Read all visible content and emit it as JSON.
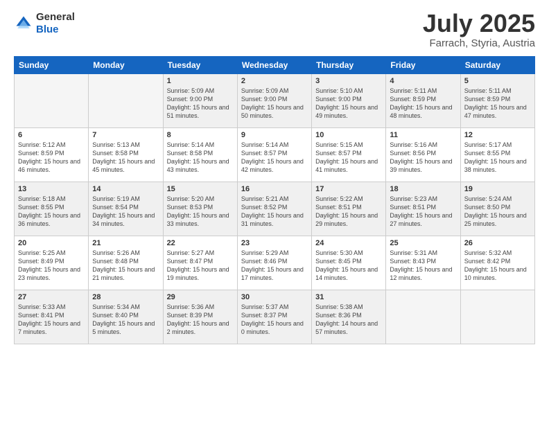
{
  "header": {
    "logo_general": "General",
    "logo_blue": "Blue",
    "month": "July 2025",
    "location": "Farrach, Styria, Austria"
  },
  "weekdays": [
    "Sunday",
    "Monday",
    "Tuesday",
    "Wednesday",
    "Thursday",
    "Friday",
    "Saturday"
  ],
  "rows": [
    [
      {
        "day": "",
        "sunrise": "",
        "sunset": "",
        "daylight": ""
      },
      {
        "day": "",
        "sunrise": "",
        "sunset": "",
        "daylight": ""
      },
      {
        "day": "1",
        "sunrise": "Sunrise: 5:09 AM",
        "sunset": "Sunset: 9:00 PM",
        "daylight": "Daylight: 15 hours and 51 minutes."
      },
      {
        "day": "2",
        "sunrise": "Sunrise: 5:09 AM",
        "sunset": "Sunset: 9:00 PM",
        "daylight": "Daylight: 15 hours and 50 minutes."
      },
      {
        "day": "3",
        "sunrise": "Sunrise: 5:10 AM",
        "sunset": "Sunset: 9:00 PM",
        "daylight": "Daylight: 15 hours and 49 minutes."
      },
      {
        "day": "4",
        "sunrise": "Sunrise: 5:11 AM",
        "sunset": "Sunset: 8:59 PM",
        "daylight": "Daylight: 15 hours and 48 minutes."
      },
      {
        "day": "5",
        "sunrise": "Sunrise: 5:11 AM",
        "sunset": "Sunset: 8:59 PM",
        "daylight": "Daylight: 15 hours and 47 minutes."
      }
    ],
    [
      {
        "day": "6",
        "sunrise": "Sunrise: 5:12 AM",
        "sunset": "Sunset: 8:59 PM",
        "daylight": "Daylight: 15 hours and 46 minutes."
      },
      {
        "day": "7",
        "sunrise": "Sunrise: 5:13 AM",
        "sunset": "Sunset: 8:58 PM",
        "daylight": "Daylight: 15 hours and 45 minutes."
      },
      {
        "day": "8",
        "sunrise": "Sunrise: 5:14 AM",
        "sunset": "Sunset: 8:58 PM",
        "daylight": "Daylight: 15 hours and 43 minutes."
      },
      {
        "day": "9",
        "sunrise": "Sunrise: 5:14 AM",
        "sunset": "Sunset: 8:57 PM",
        "daylight": "Daylight: 15 hours and 42 minutes."
      },
      {
        "day": "10",
        "sunrise": "Sunrise: 5:15 AM",
        "sunset": "Sunset: 8:57 PM",
        "daylight": "Daylight: 15 hours and 41 minutes."
      },
      {
        "day": "11",
        "sunrise": "Sunrise: 5:16 AM",
        "sunset": "Sunset: 8:56 PM",
        "daylight": "Daylight: 15 hours and 39 minutes."
      },
      {
        "day": "12",
        "sunrise": "Sunrise: 5:17 AM",
        "sunset": "Sunset: 8:55 PM",
        "daylight": "Daylight: 15 hours and 38 minutes."
      }
    ],
    [
      {
        "day": "13",
        "sunrise": "Sunrise: 5:18 AM",
        "sunset": "Sunset: 8:55 PM",
        "daylight": "Daylight: 15 hours and 36 minutes."
      },
      {
        "day": "14",
        "sunrise": "Sunrise: 5:19 AM",
        "sunset": "Sunset: 8:54 PM",
        "daylight": "Daylight: 15 hours and 34 minutes."
      },
      {
        "day": "15",
        "sunrise": "Sunrise: 5:20 AM",
        "sunset": "Sunset: 8:53 PM",
        "daylight": "Daylight: 15 hours and 33 minutes."
      },
      {
        "day": "16",
        "sunrise": "Sunrise: 5:21 AM",
        "sunset": "Sunset: 8:52 PM",
        "daylight": "Daylight: 15 hours and 31 minutes."
      },
      {
        "day": "17",
        "sunrise": "Sunrise: 5:22 AM",
        "sunset": "Sunset: 8:51 PM",
        "daylight": "Daylight: 15 hours and 29 minutes."
      },
      {
        "day": "18",
        "sunrise": "Sunrise: 5:23 AM",
        "sunset": "Sunset: 8:51 PM",
        "daylight": "Daylight: 15 hours and 27 minutes."
      },
      {
        "day": "19",
        "sunrise": "Sunrise: 5:24 AM",
        "sunset": "Sunset: 8:50 PM",
        "daylight": "Daylight: 15 hours and 25 minutes."
      }
    ],
    [
      {
        "day": "20",
        "sunrise": "Sunrise: 5:25 AM",
        "sunset": "Sunset: 8:49 PM",
        "daylight": "Daylight: 15 hours and 23 minutes."
      },
      {
        "day": "21",
        "sunrise": "Sunrise: 5:26 AM",
        "sunset": "Sunset: 8:48 PM",
        "daylight": "Daylight: 15 hours and 21 minutes."
      },
      {
        "day": "22",
        "sunrise": "Sunrise: 5:27 AM",
        "sunset": "Sunset: 8:47 PM",
        "daylight": "Daylight: 15 hours and 19 minutes."
      },
      {
        "day": "23",
        "sunrise": "Sunrise: 5:29 AM",
        "sunset": "Sunset: 8:46 PM",
        "daylight": "Daylight: 15 hours and 17 minutes."
      },
      {
        "day": "24",
        "sunrise": "Sunrise: 5:30 AM",
        "sunset": "Sunset: 8:45 PM",
        "daylight": "Daylight: 15 hours and 14 minutes."
      },
      {
        "day": "25",
        "sunrise": "Sunrise: 5:31 AM",
        "sunset": "Sunset: 8:43 PM",
        "daylight": "Daylight: 15 hours and 12 minutes."
      },
      {
        "day": "26",
        "sunrise": "Sunrise: 5:32 AM",
        "sunset": "Sunset: 8:42 PM",
        "daylight": "Daylight: 15 hours and 10 minutes."
      }
    ],
    [
      {
        "day": "27",
        "sunrise": "Sunrise: 5:33 AM",
        "sunset": "Sunset: 8:41 PM",
        "daylight": "Daylight: 15 hours and 7 minutes."
      },
      {
        "day": "28",
        "sunrise": "Sunrise: 5:34 AM",
        "sunset": "Sunset: 8:40 PM",
        "daylight": "Daylight: 15 hours and 5 minutes."
      },
      {
        "day": "29",
        "sunrise": "Sunrise: 5:36 AM",
        "sunset": "Sunset: 8:39 PM",
        "daylight": "Daylight: 15 hours and 2 minutes."
      },
      {
        "day": "30",
        "sunrise": "Sunrise: 5:37 AM",
        "sunset": "Sunset: 8:37 PM",
        "daylight": "Daylight: 15 hours and 0 minutes."
      },
      {
        "day": "31",
        "sunrise": "Sunrise: 5:38 AM",
        "sunset": "Sunset: 8:36 PM",
        "daylight": "Daylight: 14 hours and 57 minutes."
      },
      {
        "day": "",
        "sunrise": "",
        "sunset": "",
        "daylight": ""
      },
      {
        "day": "",
        "sunrise": "",
        "sunset": "",
        "daylight": ""
      }
    ]
  ]
}
